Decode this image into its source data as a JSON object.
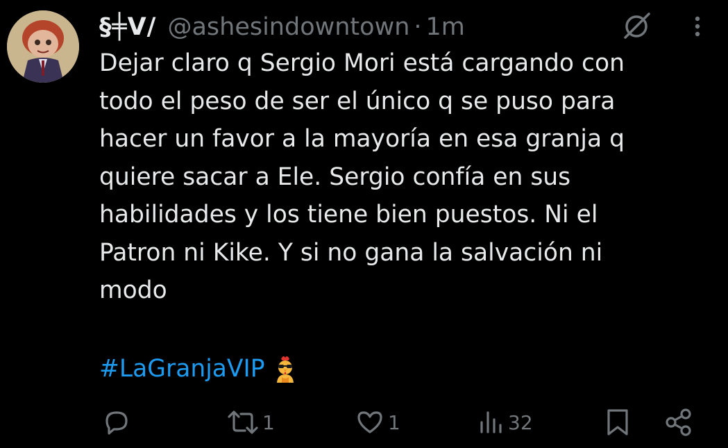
{
  "post": {
    "display_name": "§╪V/",
    "handle": "@ashesindowntown",
    "separator": "·",
    "time": "1m",
    "text": "Dejar claro q Sergio Mori está cargando con\ntodo el peso de ser el único q se puso para\nhacer un favor a la mayoría en esa granja q\nquiere sacar a Ele. Sergio confía en sus\nhabilidades y los tiene bien puestos. Ni el\nPatron ni Kike. Y si no gana la salvación ni\nmodo",
    "hashtag": "#LaGranjaVIP",
    "hashtag_emoji": "rooster-sunglasses-emoji"
  },
  "actions": {
    "reply_count": "",
    "repost_count": "1",
    "like_count": "1",
    "views_count": "32"
  },
  "icons": {
    "grok": "grok-icon",
    "more": "more-options-icon",
    "reply": "reply-icon",
    "repost": "repost-icon",
    "like": "heart-icon",
    "views": "views-icon",
    "bookmark": "bookmark-icon",
    "share": "share-icon"
  },
  "colors": {
    "background": "#000000",
    "text": "#e7e9ea",
    "secondary": "#71767b",
    "link": "#1d9bf0"
  }
}
